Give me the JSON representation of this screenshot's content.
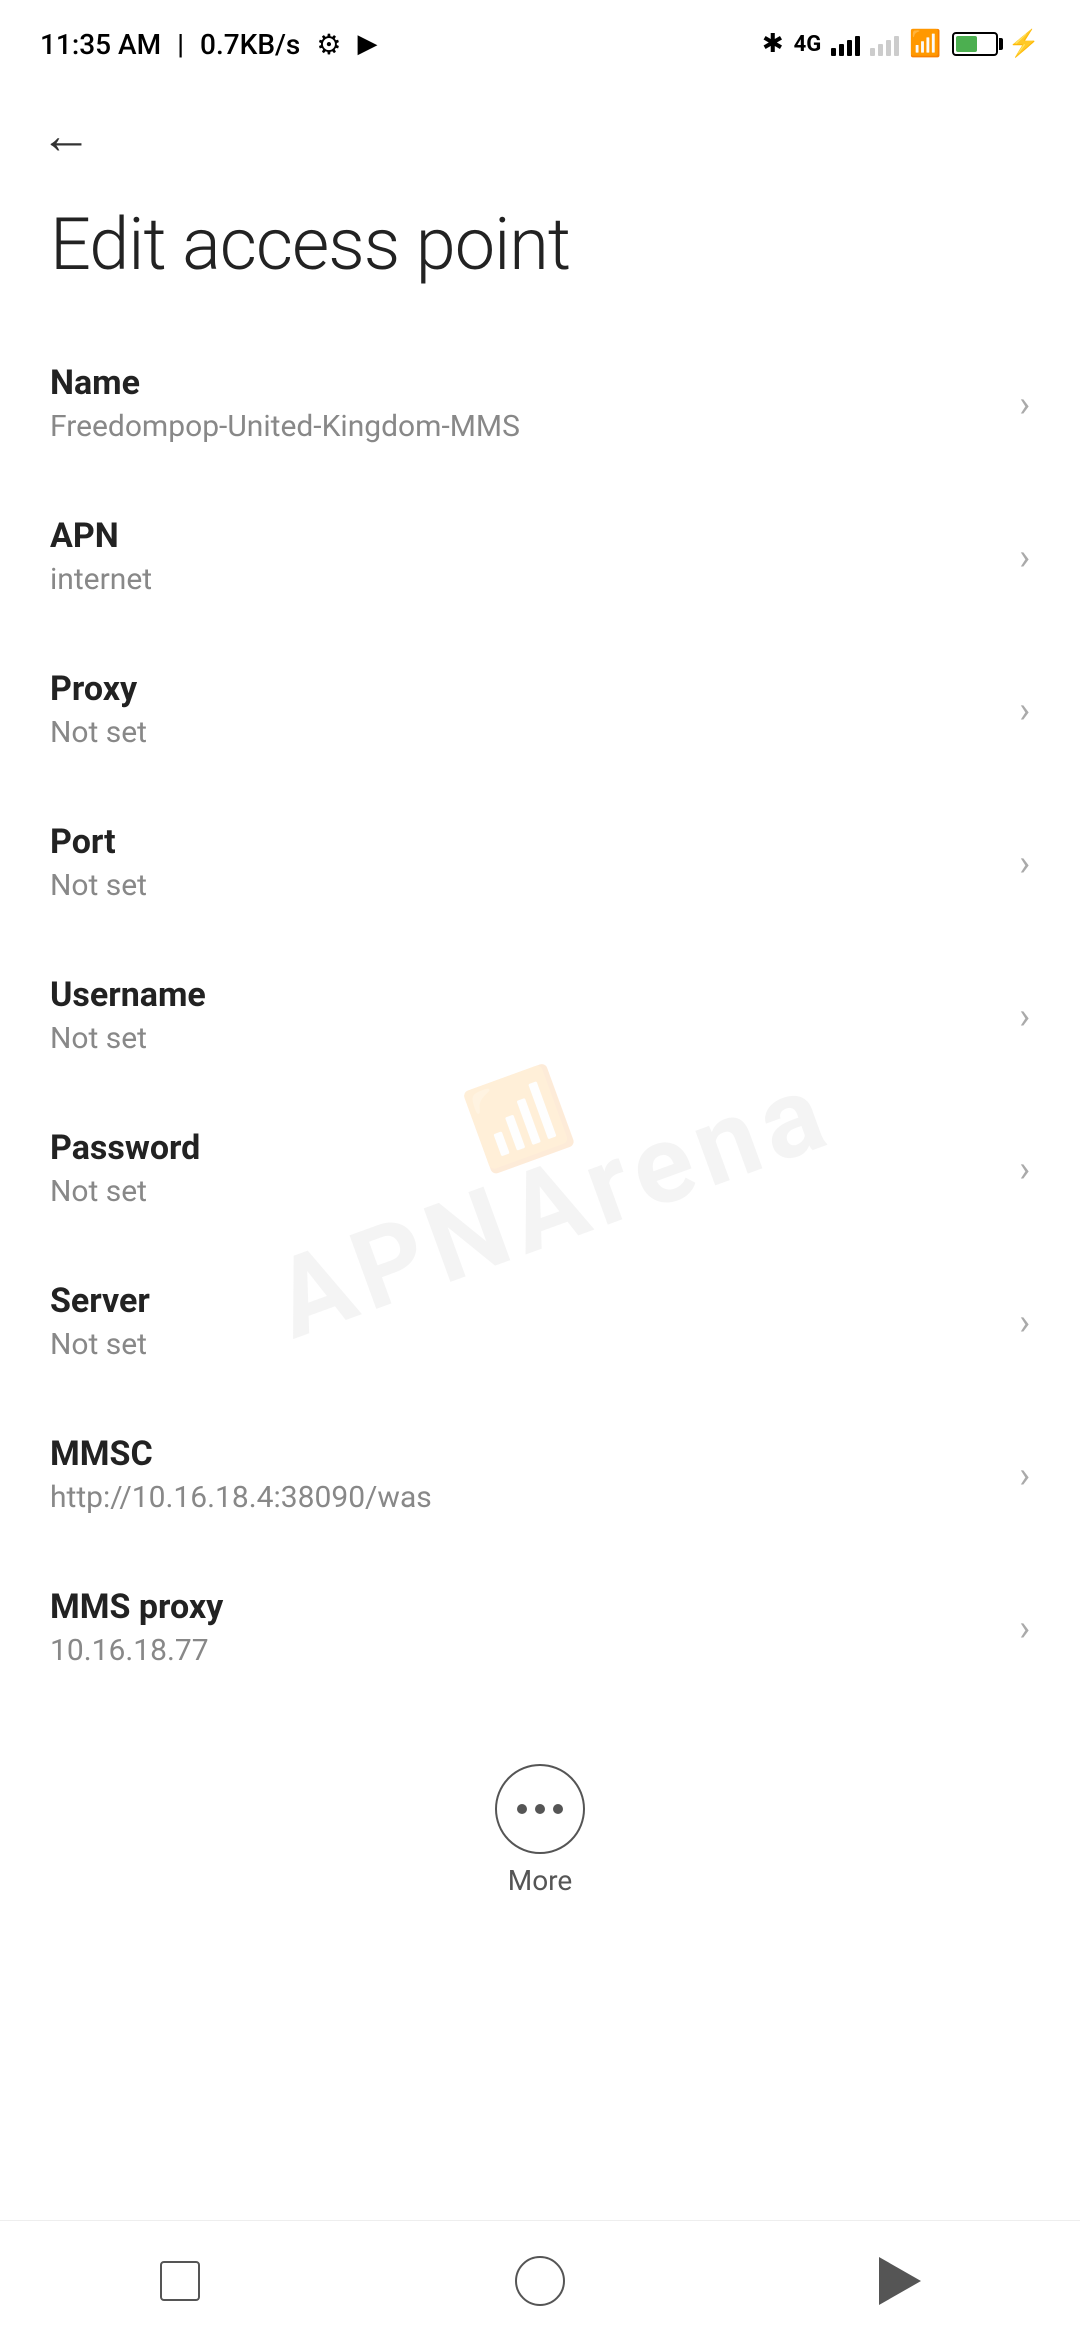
{
  "statusBar": {
    "time": "11:35 AM",
    "speed": "0.7KB/s"
  },
  "header": {
    "back_label": "←",
    "title": "Edit access point"
  },
  "settings": [
    {
      "label": "Name",
      "value": "Freedompop-United-Kingdom-MMS"
    },
    {
      "label": "APN",
      "value": "internet"
    },
    {
      "label": "Proxy",
      "value": "Not set"
    },
    {
      "label": "Port",
      "value": "Not set"
    },
    {
      "label": "Username",
      "value": "Not set"
    },
    {
      "label": "Password",
      "value": "Not set"
    },
    {
      "label": "Server",
      "value": "Not set"
    },
    {
      "label": "MMSC",
      "value": "http://10.16.18.4:38090/was"
    },
    {
      "label": "MMS proxy",
      "value": "10.16.18.77"
    }
  ],
  "more": {
    "label": "More"
  },
  "watermark": "APNArena"
}
